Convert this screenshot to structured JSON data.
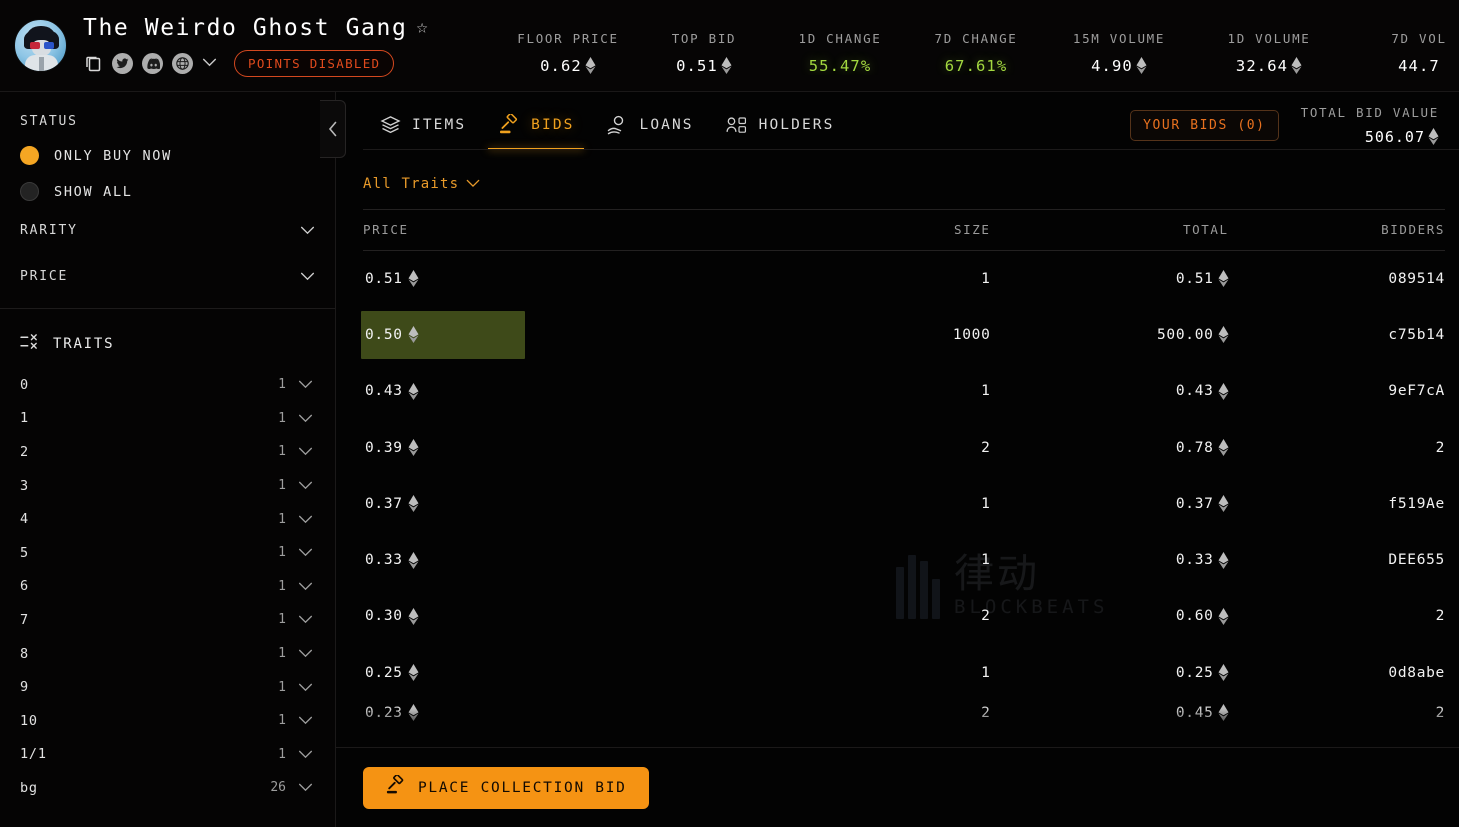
{
  "header": {
    "collection_name": "The Weirdo Ghost Gang",
    "star_icon": "star-outline-icon",
    "points_badge": "POINTS DISABLED",
    "social_icons": [
      "copy-icon",
      "twitter-icon",
      "discord-icon",
      "globe-icon",
      "chevron-down-icon"
    ],
    "stats": [
      {
        "label": "FLOOR PRICE",
        "value": "0.62",
        "eth": true,
        "trend": "none"
      },
      {
        "label": "TOP BID",
        "value": "0.51",
        "eth": true,
        "trend": "none"
      },
      {
        "label": "1D CHANGE",
        "value": "55.47%",
        "eth": false,
        "trend": "up"
      },
      {
        "label": "7D CHANGE",
        "value": "67.61%",
        "eth": false,
        "trend": "up"
      },
      {
        "label": "15M VOLUME",
        "value": "4.90",
        "eth": true,
        "trend": "none"
      },
      {
        "label": "1D VOLUME",
        "value": "32.64",
        "eth": true,
        "trend": "none"
      },
      {
        "label": "7D VOL",
        "value": "44.7",
        "eth": false,
        "trend": "none"
      }
    ]
  },
  "sidebar": {
    "status_title": "STATUS",
    "status_options": [
      {
        "label": "ONLY BUY NOW",
        "selected": true
      },
      {
        "label": "SHOW ALL",
        "selected": false
      }
    ],
    "sections": [
      {
        "label": "RARITY"
      },
      {
        "label": "PRICE"
      }
    ],
    "traits_title": "TRAITS",
    "traits": [
      {
        "name": "0",
        "count": "1"
      },
      {
        "name": "1",
        "count": "1"
      },
      {
        "name": "2",
        "count": "1"
      },
      {
        "name": "3",
        "count": "1"
      },
      {
        "name": "4",
        "count": "1"
      },
      {
        "name": "5",
        "count": "1"
      },
      {
        "name": "6",
        "count": "1"
      },
      {
        "name": "7",
        "count": "1"
      },
      {
        "name": "8",
        "count": "1"
      },
      {
        "name": "9",
        "count": "1"
      },
      {
        "name": "10",
        "count": "1"
      },
      {
        "name": "1/1",
        "count": "1"
      },
      {
        "name": "bg",
        "count": "26"
      }
    ]
  },
  "main": {
    "tabs": [
      {
        "label": "ITEMS",
        "icon": "layers-icon",
        "active": false
      },
      {
        "label": "BIDS",
        "icon": "gavel-icon",
        "active": true
      },
      {
        "label": "LOANS",
        "icon": "hand-coin-icon",
        "active": false
      },
      {
        "label": "HOLDERS",
        "icon": "users-icon",
        "active": false
      }
    ],
    "your_bids_label": "YOUR BIDS (0)",
    "total_bid_value_label": "TOTAL BID VALUE",
    "total_bid_value": "506.07",
    "traits_filter_label": "All Traits",
    "columns": [
      "PRICE",
      "SIZE",
      "TOTAL",
      "BIDDERS"
    ],
    "rows": [
      {
        "price": "0.51",
        "size": "1",
        "total": "0.51",
        "bidders": "089514",
        "depth": 0,
        "highlight": false
      },
      {
        "price": "0.50",
        "size": "1000",
        "total": "500.00",
        "bidders": "c75b14",
        "depth": 0.4,
        "highlight": true
      },
      {
        "price": "0.43",
        "size": "1",
        "total": "0.43",
        "bidders": "9eF7cA",
        "depth": 0,
        "highlight": false
      },
      {
        "price": "0.39",
        "size": "2",
        "total": "0.78",
        "bidders": "2",
        "depth": 0,
        "highlight": false
      },
      {
        "price": "0.37",
        "size": "1",
        "total": "0.37",
        "bidders": "f519Ae",
        "depth": 0,
        "highlight": false
      },
      {
        "price": "0.33",
        "size": "1",
        "total": "0.33",
        "bidders": "DEE655",
        "depth": 0,
        "highlight": false
      },
      {
        "price": "0.30",
        "size": "2",
        "total": "0.60",
        "bidders": "2",
        "depth": 0,
        "highlight": false
      },
      {
        "price": "0.25",
        "size": "1",
        "total": "0.25",
        "bidders": "0d8abe",
        "depth": 0,
        "highlight": false
      },
      {
        "price": "0.23",
        "size": "2",
        "total": "0.45",
        "bidders": "2",
        "depth": 0,
        "highlight": false
      }
    ],
    "place_bid_label": "PLACE COLLECTION BID"
  },
  "watermark": {
    "cn": "律动",
    "en": "BLOCKBEATS"
  }
}
